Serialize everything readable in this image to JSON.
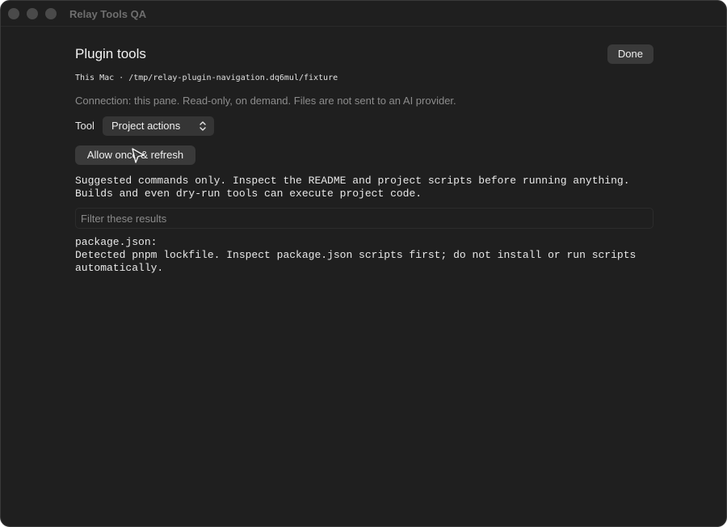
{
  "window": {
    "title": "Relay Tools QA"
  },
  "header": {
    "title": "Plugin tools",
    "done_label": "Done"
  },
  "location": "This Mac · /tmp/relay-plugin-navigation.dq6mul/fixture",
  "connection": "Connection: this pane. Read-only, on demand. Files are not sent to an AI provider.",
  "tool": {
    "label": "Tool",
    "selected": "Project actions"
  },
  "allow_label": "Allow once & refresh",
  "notice": {
    "line1": "Suggested commands only. Inspect the README and project scripts before running anything.",
    "line2": "Builds and even dry-run tools can execute project code."
  },
  "filter": {
    "placeholder": "Filter these results",
    "value": ""
  },
  "results": {
    "file": "package.json:",
    "line1": "Detected pnpm lockfile. Inspect package.json scripts first; do not install or run scripts",
    "line2": "automatically."
  },
  "colors": {
    "background": "#1f1f1f",
    "button": "#3a3a3a",
    "muted_text": "#8c8c8c"
  },
  "icons": {
    "select": "chevron-updown-icon",
    "cursor": "cursor-icon"
  }
}
